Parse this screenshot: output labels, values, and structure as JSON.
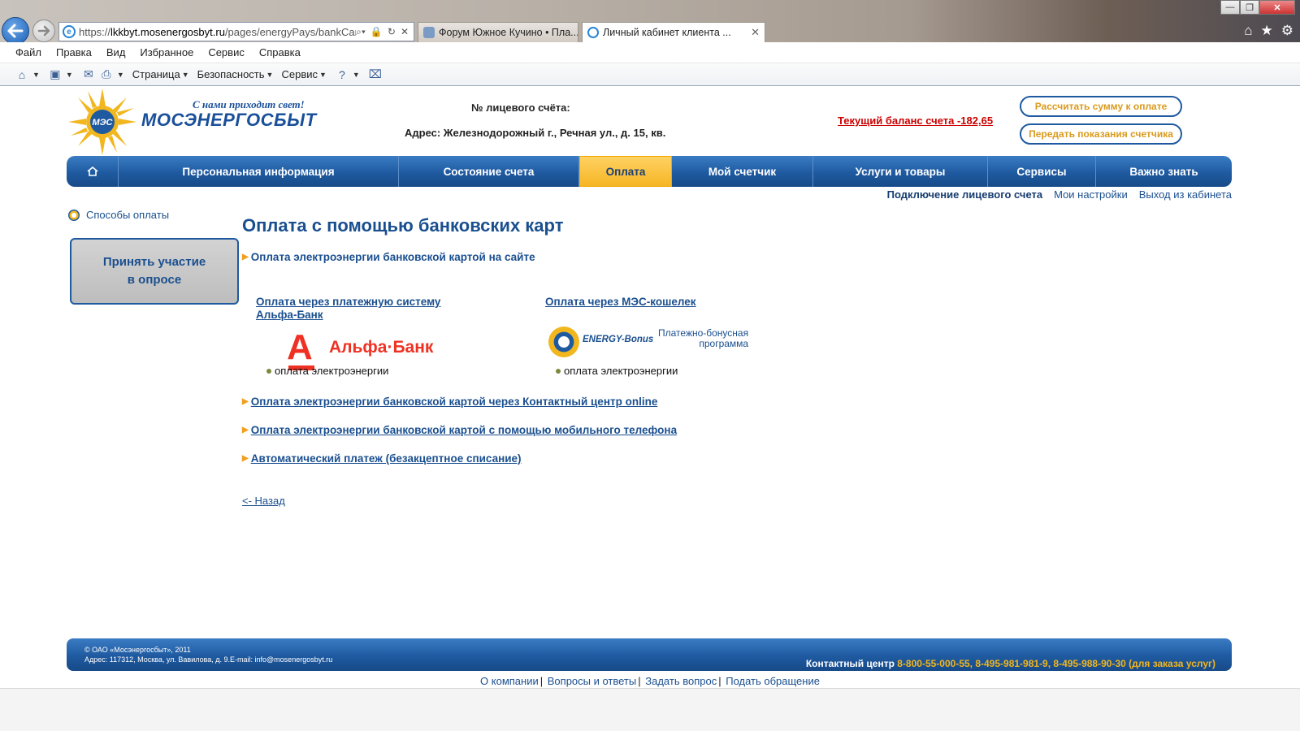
{
  "browser": {
    "url_prefix": "https://",
    "url_domain": "lkkbyt.mosenergosbyt.ru",
    "url_path": "/pages/energyPays/bankCard",
    "tabs": [
      {
        "title": "Форум Южное Кучино • Пла..."
      },
      {
        "title": "Личный кабинет клиента ..."
      }
    ],
    "menu": [
      "Файл",
      "Правка",
      "Вид",
      "Избранное",
      "Сервис",
      "Справка"
    ],
    "commands": [
      "Страница",
      "Безопасность",
      "Сервис"
    ]
  },
  "header": {
    "slogan": "С нами приходит свет!",
    "brand": "МОСЭНЕРГОСБЫТ",
    "account_label": "№ лицевого счёта:",
    "address": "Адрес: Железнодорожный г., Речная ул., д. 15, кв.",
    "balance": "Текущий баланс счета -182,65",
    "calc_button": "Рассчитать сумму к оплате",
    "meter_button": "Передать показания счетчика"
  },
  "nav": {
    "items": [
      "Персональная информация",
      "Состояние счета",
      "Оплата",
      "Мой счетчик",
      "Услуги и товары",
      "Сервисы",
      "Важно знать"
    ],
    "active": "Оплата"
  },
  "sublinks": [
    "Подключение лицевого счета",
    "Мои настройки",
    "Выход из кабинета"
  ],
  "sidebar": {
    "link": "Способы оплаты",
    "poll_line1": "Принять участие",
    "poll_line2": "в опросе"
  },
  "main": {
    "title": "Оплата с помощью банковских карт",
    "section_online": "Оплата электроэнергии банковской картой на сайте",
    "alfa_title_line1": "Оплата через платежную систему",
    "alfa_title_line2": "Альфа-Банк",
    "alfa_logo_text": "Альфа·Банк",
    "mes_title": "Оплата через МЭС-кошелек",
    "mes_logo_name": "ENERGY-Bonus",
    "mes_logo_sub_line1": "Платежно-бонусная",
    "mes_logo_sub_line2": "программа",
    "sub_item": "оплата электроэнергии",
    "link_contact_center": "Оплата электроэнергии банковской картой через Контактный центр online",
    "link_mobile": "Оплата электроэнергии банковской картой с помощью мобильного телефона",
    "link_auto": "Автоматический платеж (безакцептное списание)",
    "back": "<- Назад"
  },
  "footer": {
    "copyright": "© ОАО «Мосэнергосбыт», 2011",
    "address": "Адрес: 117312, Москва, ул. Вавилова, д. 9.E-mail: info@mosenergosbyt.ru",
    "contact_label": "Контактный центр",
    "phones": "8-800-55-000-55, 8-495-981-981-9, 8-495-988-90-30 (для заказа услуг)",
    "links": [
      "О компании",
      "Вопросы и ответы",
      "Задать вопрос",
      "Подать обращение"
    ]
  },
  "colors": {
    "brand_blue": "#1f5aa0",
    "accent_orange": "#f2b61e",
    "balance_red": "#cc0000"
  }
}
